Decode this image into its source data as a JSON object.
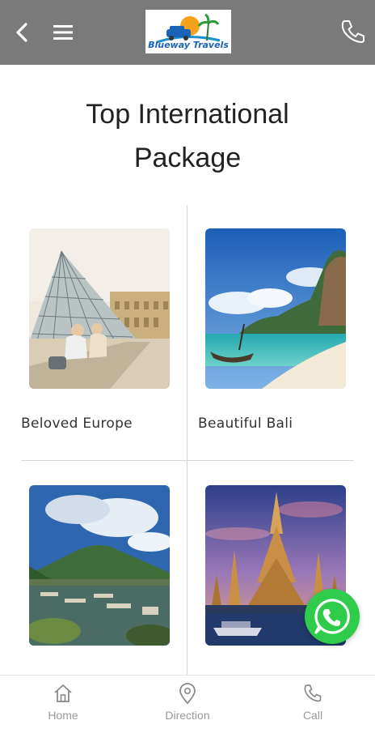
{
  "appbar": {
    "logo_text": "Blueway Travels",
    "background": "#7a7a7a",
    "icons": [
      "back-arrow-icon",
      "hamburger-menu-icon",
      "phone-icon"
    ]
  },
  "page": {
    "title_line1": "Top International",
    "title_line2": "Package"
  },
  "packages": [
    {
      "label": "Beloved Europe"
    },
    {
      "label": "Beautiful Bali"
    },
    {
      "label": ""
    },
    {
      "label": ""
    }
  ],
  "whatsapp": {
    "color": "#2ecc4a",
    "icon": "whatsapp-icon"
  },
  "bottom_nav": [
    {
      "label": "Home",
      "icon": "home-icon"
    },
    {
      "label": "Direction",
      "icon": "location-pin-icon"
    },
    {
      "label": "Call",
      "icon": "phone-icon"
    }
  ]
}
